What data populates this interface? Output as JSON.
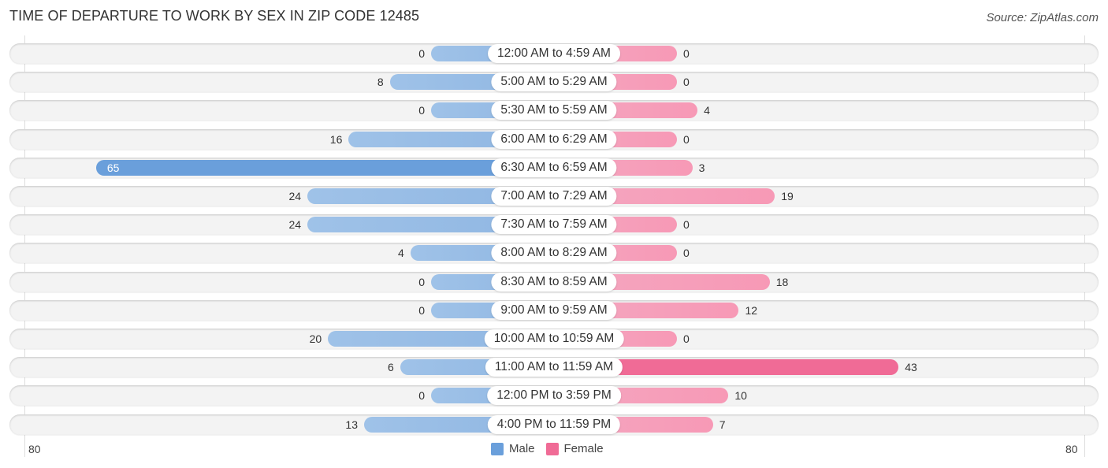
{
  "title": "TIME OF DEPARTURE TO WORK BY SEX IN ZIP CODE 12485",
  "source": "Source: ZipAtlas.com",
  "colors": {
    "male": "#6a9fdb",
    "female": "#f06b96"
  },
  "chart_data": {
    "type": "bar",
    "orientation": "horizontal-diverging",
    "title": "TIME OF DEPARTURE TO WORK BY SEX IN ZIP CODE 12485",
    "categories": [
      "12:00 AM to 4:59 AM",
      "5:00 AM to 5:29 AM",
      "5:30 AM to 5:59 AM",
      "6:00 AM to 6:29 AM",
      "6:30 AM to 6:59 AM",
      "7:00 AM to 7:29 AM",
      "7:30 AM to 7:59 AM",
      "8:00 AM to 8:29 AM",
      "8:30 AM to 8:59 AM",
      "9:00 AM to 9:59 AM",
      "10:00 AM to 10:59 AM",
      "11:00 AM to 11:59 AM",
      "12:00 PM to 3:59 PM",
      "4:00 PM to 11:59 PM"
    ],
    "series": [
      {
        "name": "Male",
        "values": [
          0,
          8,
          0,
          16,
          65,
          24,
          24,
          4,
          0,
          0,
          20,
          6,
          0,
          13
        ]
      },
      {
        "name": "Female",
        "values": [
          0,
          0,
          4,
          0,
          3,
          19,
          0,
          0,
          18,
          12,
          0,
          43,
          10,
          7
        ]
      }
    ],
    "axis": {
      "left_label": "80",
      "right_label": "80",
      "xlim": [
        -80,
        80
      ]
    },
    "legend": {
      "entries": [
        "Male",
        "Female"
      ],
      "placement": "bottom-center"
    },
    "grid": false
  }
}
